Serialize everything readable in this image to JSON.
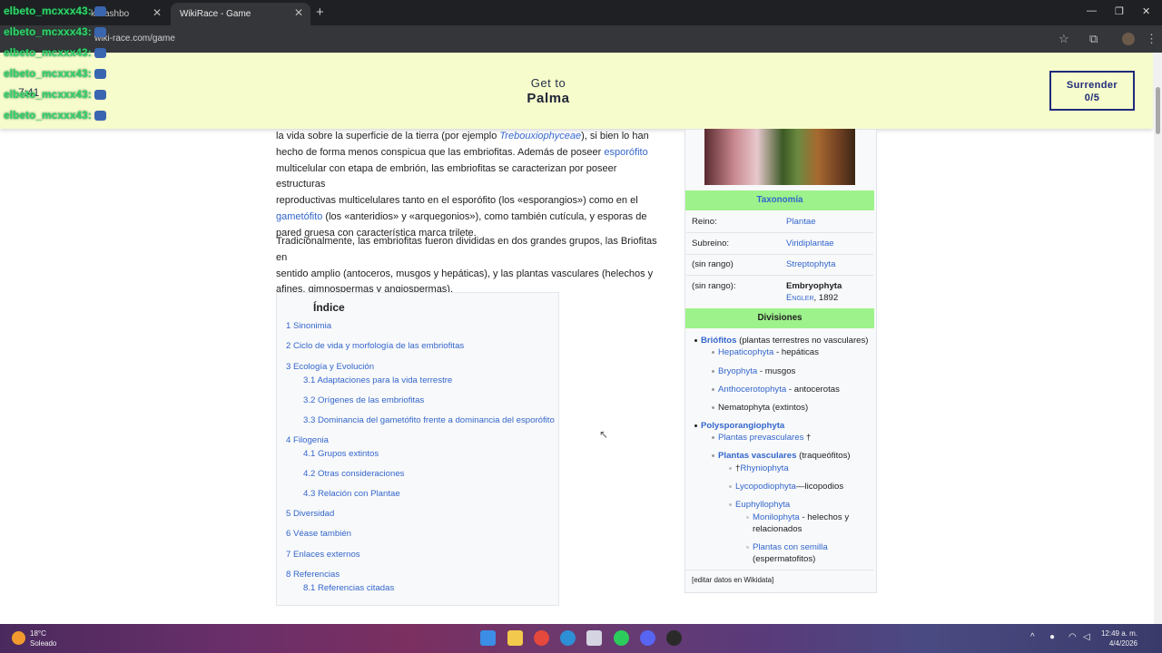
{
  "browser": {
    "tabs": [
      {
        "label": "k Dashbo"
      },
      {
        "label": "WikiRace - Game"
      }
    ],
    "url": "wiki-race.com/game",
    "new_tab": "+",
    "win_min": "—",
    "win_max": "❐",
    "win_close": "✕",
    "tab_close": "✕"
  },
  "game": {
    "get_to_label": "Get to",
    "target": "Palma",
    "surrender_label": "Surrender",
    "surrender_count": "0/5",
    "timer": "7:41"
  },
  "chat": [
    "elbeto_mcxxx43:",
    "elbeto_mcxxx43:",
    "elbeto_mcxxx43:",
    "elbeto_mcxxx43:",
    "elbeto_mcxxx43:",
    "elbeto_mcxxx43:"
  ],
  "article": {
    "p1_l1_a": "la vida sobre la superficie de la tierra (por ejemplo ",
    "p1_l1_link": "Trebouxiophyceae",
    "p1_l1_b": "), si bien lo han",
    "p1_l2_a": "hecho de forma menos conspicua que las embriofitas. Además de poseer ",
    "p1_l2_link": "esporófito",
    "p1_l3": "multicelular con etapa de embrión, las embriofitas se caracterizan por poseer estructuras",
    "p1_l4": "reproductivas multicelulares tanto en el esporófito (los «esporangios») como en el",
    "p1_l5_link": "gametófito",
    "p1_l5_b": " (los «anteridios» y «arquegonios»), como también cutícula, y esporas de",
    "p1_l6": "pared gruesa con característica marca trilete.",
    "p2_l1": "Tradicionalmente, las embriofitas fueron divididas en dos grandes grupos, las Briofitas en",
    "p2_l2": "sentido amplio (antoceros, musgos y hepáticas), y las plantas vasculares (helechos y",
    "p2_l3": "afines, gimnospermas y angiospermas)."
  },
  "toc": {
    "title": "Índice",
    "items": [
      "1 Sinonimia",
      "2 Ciclo de vida y morfología de las embriofitas",
      "3 Ecología y Evolución",
      "3.1 Adaptaciones para la vida terrestre",
      "3.2 Orígenes de las embriofitas",
      "3.3 Dominancia del gametófito frente a dominancia del esporófito",
      "4 Filogenia",
      "4.1 Grupos extintos",
      "4.2 Otras consideraciones",
      "4.3 Relación con Plantae",
      "5 Diversidad",
      "6 Véase también",
      "7 Enlaces externos",
      "8 Referencias",
      "8.1 Referencias citadas"
    ]
  },
  "infobox": {
    "taxonomia_header": "Taxonomía",
    "rows": [
      {
        "key": "Reino:",
        "value": "Plantae"
      },
      {
        "key": "Subreino:",
        "value": "Viridiplantae"
      },
      {
        "key": "(sin rango)",
        "value": "Streptophyta"
      },
      {
        "key": "(sin rango):",
        "value": "Embryophyta"
      }
    ],
    "author": "Engler",
    "author_year": ", 1892",
    "divisiones_header": "Divisiones",
    "div": {
      "briofitos": "Briófitos",
      "briofitos_desc": " (plantas terrestres no vasculares)",
      "hepaticophyta": "Hepaticophyta",
      "hepaticophyta_desc": " - hepáticas",
      "bryophyta": "Bryophyta",
      "bryophyta_desc": " - musgos",
      "anthocerotophyta": "Anthocerotophyta",
      "anthocerotophyta_desc": " - antocerotas",
      "nematophyta": "Nematophyta (extintos)",
      "polysporangiophyta": "Polysporangiophyta",
      "prevasculares": "Plantas prevasculares",
      "prevasculares_dagger": " †",
      "vasculares": "Plantas vasculares",
      "vasculares_desc": " (traqueófitos)",
      "rhyniophyta_dagger": "†",
      "rhyniophyta": "Rhyniophyta",
      "lycopodiophyta": "Lycopodiophyta",
      "lycopodiophyta_desc": "—licopodios",
      "euphyllophyta": "Euphyllophyta",
      "monilophyta": "Monilophyta",
      "monilophyta_desc": " - helechos y",
      "monilophyta_desc2": "relacionados",
      "semilla": "Plantas con semilla",
      "semilla_desc": "(espermatofitos)"
    },
    "edit_link": "[editar datos en Wikidata]"
  },
  "taskbar": {
    "temp": "18°C",
    "weather": "Soleado",
    "time": "12:49 a. m.",
    "date": "4/4/2026"
  },
  "colors": {
    "banner_bg": "#f6fccb",
    "chat_green": "#31d66b",
    "infobox_header": "#9df28b",
    "link": "#3366cc"
  }
}
